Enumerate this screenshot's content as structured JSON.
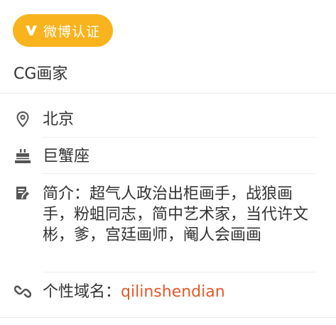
{
  "badge": {
    "label": "微博认证",
    "color": "#f9b31d"
  },
  "headline": "CG画家",
  "info": {
    "location": {
      "icon": "location-pin-icon",
      "text": "北京"
    },
    "zodiac": {
      "icon": "birthday-cake-icon",
      "text": "巨蟹座"
    },
    "intro": {
      "icon": "edit-note-icon",
      "label": "简介：",
      "text": "超气人政治出柜画手，战狼画手，粉蛆同志，简中艺术家，当代许文彬，爹，宫廷画师，阉人会画画"
    },
    "domain": {
      "icon": "link-icon",
      "label": "个性域名：",
      "text": "qilinshendian",
      "color": "#e05a2b"
    }
  }
}
